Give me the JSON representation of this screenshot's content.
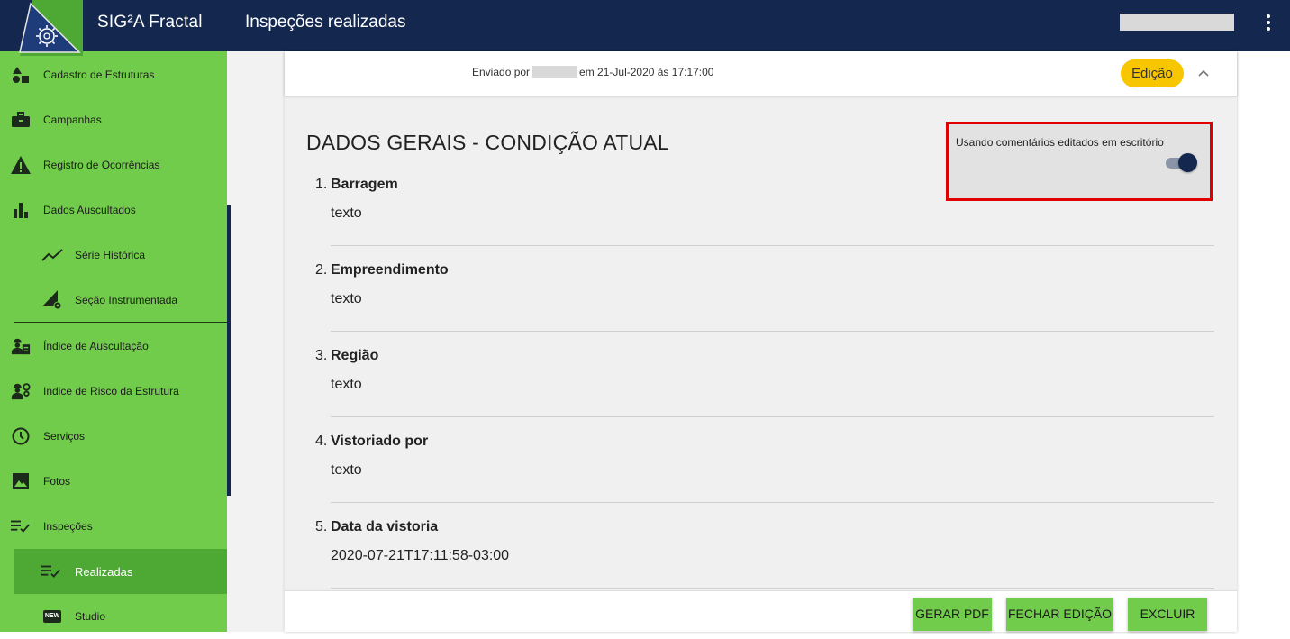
{
  "header": {
    "app_title": "SIG²A Fractal",
    "page_title": "Inspeções realizadas"
  },
  "sidebar": {
    "items": [
      {
        "label": "Cadastro de Estruturas",
        "icon": "shapes-icon"
      },
      {
        "label": "Campanhas",
        "icon": "briefcase-icon"
      },
      {
        "label": "Registro de Ocorrências",
        "icon": "warning-icon"
      },
      {
        "label": "Dados Auscultados",
        "icon": "bar-chart-icon"
      },
      {
        "label": "Série Histórica",
        "icon": "trending-icon"
      },
      {
        "label": "Seção Instrumentada",
        "icon": "section-gear-icon"
      },
      {
        "label": "Índice de Auscultação",
        "icon": "engineer-clipboard-icon"
      },
      {
        "label": "Indice de Risco da Estrutura",
        "icon": "engineer-gear-icon"
      },
      {
        "label": "Serviços",
        "icon": "clock-icon"
      },
      {
        "label": "Fotos",
        "icon": "image-icon"
      },
      {
        "label": "Inspeções",
        "icon": "checklist-icon"
      },
      {
        "label": "Realizadas",
        "icon": "checklist-icon"
      },
      {
        "label": "Studio",
        "icon": "new-badge-icon",
        "badge": "NEW"
      }
    ]
  },
  "inspection": {
    "sent_prefix": "Enviado por",
    "sent_suffix": "em 21-Jul-2020 às 17:17:00",
    "status": "Edição",
    "section_title": "DADOS GERAIS - CONDIÇÃO ATUAL",
    "toggle_label": "Usando comentários editados em escritório",
    "toggle_on": true,
    "fields": [
      {
        "num": "1.",
        "name": "Barragem",
        "value": "texto"
      },
      {
        "num": "2.",
        "name": "Empreendimento",
        "value": "texto"
      },
      {
        "num": "3.",
        "name": "Região",
        "value": "texto"
      },
      {
        "num": "4.",
        "name": "Vistoriado por",
        "value": "texto"
      },
      {
        "num": "5.",
        "name": "Data da vistoria",
        "value": "2020-07-21T17:11:58-03:00"
      }
    ]
  },
  "actions": {
    "pdf": "GERAR PDF",
    "close_edit": "FECHAR EDIÇÃO",
    "delete": "EXCLUIR"
  },
  "colors": {
    "topbar": "#14284f",
    "sidebar": "#72cc4b",
    "sidebar_active": "#4ea834",
    "badge": "#f7c600",
    "highlight_border": "#e00000"
  }
}
